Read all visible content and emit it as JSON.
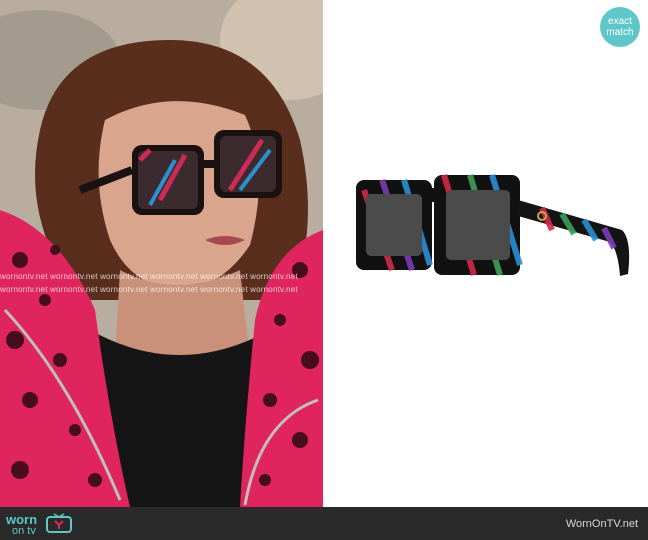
{
  "photo": {
    "watermark_text": "wornontv.net wornontv.net wornontv.net wornontv.net wornontv.net wornontv.net"
  },
  "badge": {
    "line1": "exact",
    "line2": "match"
  },
  "footer": {
    "logo_worn": "worn",
    "logo_on": "on tv",
    "brand": "WornOnTV.net"
  },
  "colors": {
    "accent": "#5fc7c9",
    "footer_bg": "#2a2a2a",
    "jacket": "#e0245e"
  },
  "icons": [
    "tv-icon",
    "sunglasses-image"
  ]
}
